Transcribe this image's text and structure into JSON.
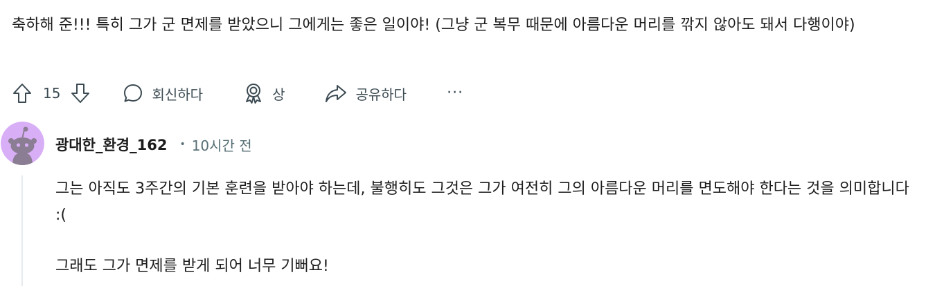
{
  "top_comment": {
    "text": "축하해 준!!! 특히 그가 군 면제를 받았으니 그에게는 좋은 일이야! (그냥 군 복무 때문에 아름다운 머리를 깎지 않아도 돼서 다행이야)"
  },
  "actions": {
    "vote_count": "15",
    "reply_label": "회신하다",
    "award_label": "상",
    "share_label": "공유하다",
    "more_label": "···"
  },
  "icons": {
    "upvote": "upvote-icon",
    "downvote": "downvote-icon",
    "reply": "comment-bubble-icon",
    "award": "award-icon",
    "share": "share-arrow-icon",
    "more": "more-horizontal-icon",
    "avatar": "snoo-avatar-icon"
  },
  "reply": {
    "username": "광대한_환경_162",
    "separator": "•",
    "timestamp": "10시간 전",
    "paragraphs": [
      "그는 아직도 3주간의 기본 훈련을 받아야 하는데, 불행히도 그것은 그가 여전히 그의 아름다운 머리를 면도해야 한다는 것을 의미합니다 :(",
      "그래도 그가 면제를 받게 되어 너무 기뻐요!"
    ]
  },
  "colors": {
    "text_primary": "#1c1c1c",
    "text_secondary": "#576f76",
    "action_text": "#3b4a52",
    "avatar_bg": "#d8aef7",
    "thread_line": "#e5ebee"
  }
}
